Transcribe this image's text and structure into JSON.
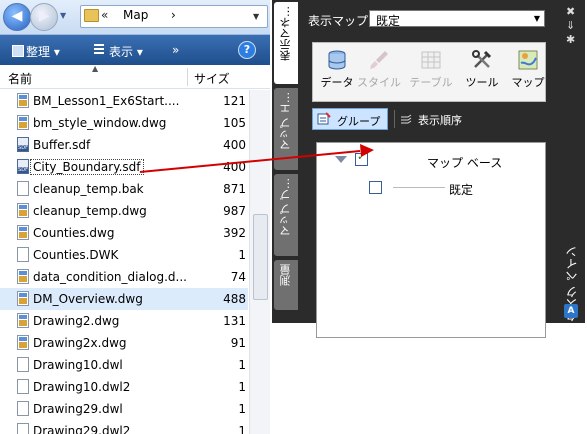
{
  "explorer": {
    "address": {
      "chevrons": "«",
      "path": "Map",
      "separator": "›"
    },
    "toolbar": {
      "organize": "整理 ▾",
      "views": "表示 ▾",
      "more": "»",
      "help": "?"
    },
    "columns": {
      "name": "名前",
      "size": "サイズ"
    },
    "files": [
      {
        "name": "BM_Lesson1_Ex6Start....",
        "size": "121",
        "icon": "dwg-file-icon"
      },
      {
        "name": "bm_style_window.dwg",
        "size": "105",
        "icon": "dwg-file-icon"
      },
      {
        "name": "Buffer.sdf",
        "size": "400",
        "icon": "sdf-file-icon"
      },
      {
        "name": "City_Boundary.sdf",
        "size": "400",
        "icon": "sdf-file-icon"
      },
      {
        "name": "cleanup_temp.bak",
        "size": "871",
        "icon": "blank-file-icon"
      },
      {
        "name": "cleanup_temp.dwg",
        "size": "987",
        "icon": "dwg-file-icon"
      },
      {
        "name": "Counties.dwg",
        "size": "392",
        "icon": "dwg-file-icon"
      },
      {
        "name": "Counties.DWK",
        "size": "1",
        "icon": "blank-file-icon"
      },
      {
        "name": "data_condition_dialog.d...",
        "size": "74",
        "icon": "dwg-file-icon"
      },
      {
        "name": "DM_Overview.dwg",
        "size": "488",
        "icon": "dwg-file-icon"
      },
      {
        "name": "Drawing2.dwg",
        "size": "131",
        "icon": "dwg-file-icon"
      },
      {
        "name": "Drawing2x.dwg",
        "size": "91",
        "icon": "dwg-file-icon"
      },
      {
        "name": "Drawing10.dwl",
        "size": "1",
        "icon": "blank-file-icon"
      },
      {
        "name": "Drawing10.dwl2",
        "size": "1",
        "icon": "blank-file-icon"
      },
      {
        "name": "Drawing29.dwl",
        "size": "1",
        "icon": "blank-file-icon"
      },
      {
        "name": "Drawing29.dwl2",
        "size": "1",
        "icon": "blank-file-icon"
      }
    ]
  },
  "taskpane": {
    "tabs": [
      {
        "label": "表示マネ…"
      },
      {
        "label": "マップ エ…"
      },
      {
        "label": "マップ ブ…"
      },
      {
        "label": "測量"
      }
    ],
    "display_map_label": "表示マップ:",
    "display_map_value": "既定",
    "ribbon": [
      {
        "label": "データ"
      },
      {
        "label": "スタイル"
      },
      {
        "label": "テーブル"
      },
      {
        "label": "ツール"
      },
      {
        "label": "マップ"
      }
    ],
    "group_button": "グループ",
    "draw_order_button": "表示順序",
    "tree": {
      "base": "マップ ベース",
      "child": "既定"
    },
    "title": "タスク ペイン",
    "strip": {
      "close": "✖",
      "autohide": "⇓",
      "properties": "✱",
      "logo": "A"
    }
  },
  "colors": {
    "selection": "#dcebfc",
    "toolbar": "#2b5c9e",
    "pane_bg": "#2b2b2b",
    "arrow": "#d40000"
  }
}
